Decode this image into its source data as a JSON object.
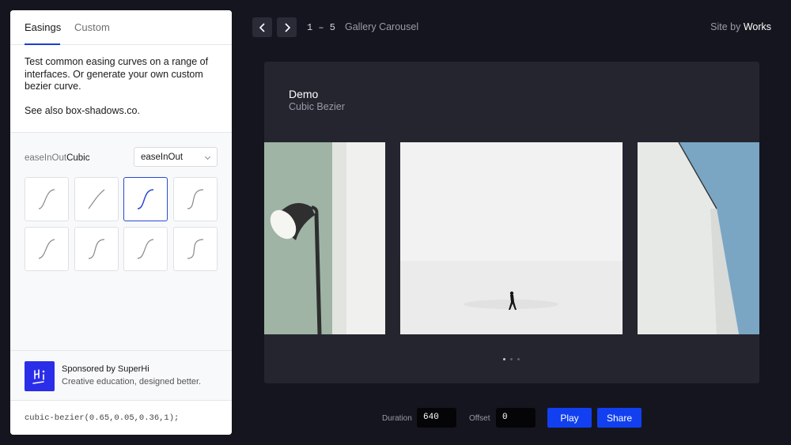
{
  "tabs": [
    {
      "label": "Easings"
    },
    {
      "label": "Custom"
    }
  ],
  "intro": {
    "description": "Test common easing curves on a range of interfaces. Or generate your own custom bezier curve.",
    "see_also": "See also box-shadows.co."
  },
  "easing": {
    "name_prefix": "easeInOut",
    "name_suffix": "Cubic",
    "select_value": "easeInOut",
    "active_curve": 2
  },
  "sponsor": {
    "title": "Sponsored by SuperHi",
    "subtitle": "Creative education, designed better.",
    "logo_text": "Hi"
  },
  "code": "cubic-bezier(0.65,0.05,0.36,1);",
  "topbar": {
    "counter": "1 – 5",
    "title": "Gallery Carousel",
    "site_by_prefix": "Site by",
    "site_by_link": "Works"
  },
  "demo": {
    "title": "Demo",
    "subtitle": "Cubic Bezier",
    "active_dot": 0,
    "dot_count": 3
  },
  "controls": {
    "duration_label": "Duration",
    "duration_value": "640",
    "offset_label": "Offset",
    "offset_value": "0",
    "play_label": "Play",
    "share_label": "Share"
  },
  "colors": {
    "background": "#15151f",
    "accent": "#1240f0",
    "card": "#252530"
  }
}
